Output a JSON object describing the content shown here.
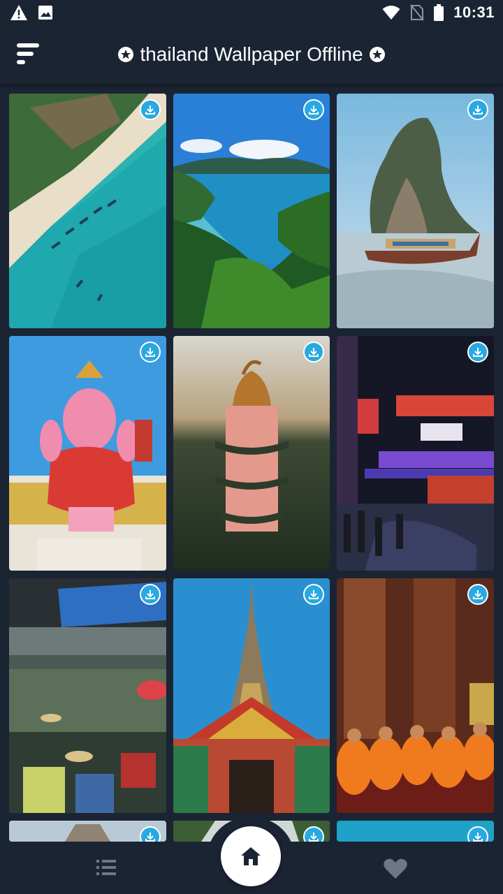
{
  "status_bar": {
    "time": "10:31",
    "icons": [
      "alert-triangle-icon",
      "image-icon",
      "wifi-icon",
      "no-sim-icon",
      "battery-icon"
    ]
  },
  "header": {
    "title": "thailand Wallpaper Offline",
    "menu_icon": "menu-icon",
    "title_icons": [
      "star-badge-icon",
      "star-badge-icon"
    ]
  },
  "wallpapers": [
    {
      "subject": "aerial-beach-boats",
      "download_icon": "download-icon"
    },
    {
      "subject": "tropical-bay-jungle",
      "download_icon": "download-icon"
    },
    {
      "subject": "limestone-rock-longtail-boat",
      "download_icon": "download-icon"
    },
    {
      "subject": "pink-ganesha-statue",
      "download_icon": "download-icon"
    },
    {
      "subject": "dragon-temple-tower",
      "download_icon": "download-icon"
    },
    {
      "subject": "chinatown-night-street",
      "download_icon": "download-icon"
    },
    {
      "subject": "floating-market",
      "download_icon": "download-icon"
    },
    {
      "subject": "temple-spire",
      "download_icon": "download-icon"
    },
    {
      "subject": "monks-in-temple",
      "download_icon": "download-icon"
    },
    {
      "subject": "stupa-partial",
      "download_icon": "download-icon"
    },
    {
      "subject": "palms-partial",
      "download_icon": "download-icon"
    },
    {
      "subject": "water-partial",
      "download_icon": "download-icon"
    }
  ],
  "bottom_nav": {
    "left_icon": "list-icon",
    "center_icon": "home-icon",
    "right_icon": "heart-icon"
  },
  "colors": {
    "background": "#1b2433",
    "accent": "#29a9e1"
  }
}
